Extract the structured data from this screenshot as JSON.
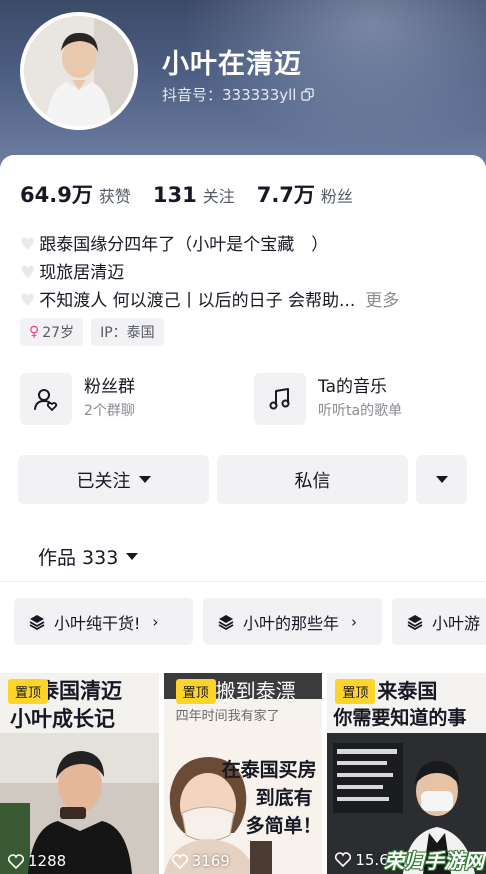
{
  "profile": {
    "nickname": "小叶在清迈",
    "douyin_id": "抖音号：333333yll"
  },
  "stats": [
    {
      "value": "64.9万",
      "label": "获赞"
    },
    {
      "value": "131",
      "label": "关注"
    },
    {
      "value": "7.7万",
      "label": "粉丝"
    }
  ],
  "bio": {
    "line1": "跟泰国缘分四年了（小叶是个宝藏　）",
    "line2": "现旅居清迈",
    "line3": "不知渡人 何以渡己丨以后的日子 会帮助...",
    "more": "更多"
  },
  "tags": {
    "age": "27岁",
    "gender_symbol": "♀",
    "ip": "IP：泰国"
  },
  "features": {
    "fans_group": {
      "title": "粉丝群",
      "subtitle": "2个群聊"
    },
    "music": {
      "title": "Ta的音乐",
      "subtitle": "听听ta的歌单"
    }
  },
  "actions": {
    "follow": "已关注",
    "message": "私信"
  },
  "works_tab": "作品 333",
  "collections": [
    {
      "label": "小叶纯干货!"
    },
    {
      "label": "小叶的那些年"
    },
    {
      "label": "小叶游"
    }
  ],
  "videos": [
    {
      "pin": "置顶",
      "title_a": "泰国清迈",
      "title_b": "小叶成长记",
      "likes": "1288"
    },
    {
      "pin": "置顶",
      "title_a": "搬到泰漂",
      "title_b": "四年时间我有家了",
      "bubble_a": "在泰国买房",
      "bubble_b": "到底有",
      "bubble_c": "多简单！",
      "likes": "3169"
    },
    {
      "pin": "置顶",
      "title_a": "来泰国",
      "title_b": "你需要知道的事",
      "likes": "15.6万"
    }
  ],
  "watermark": "荣归手游网"
}
